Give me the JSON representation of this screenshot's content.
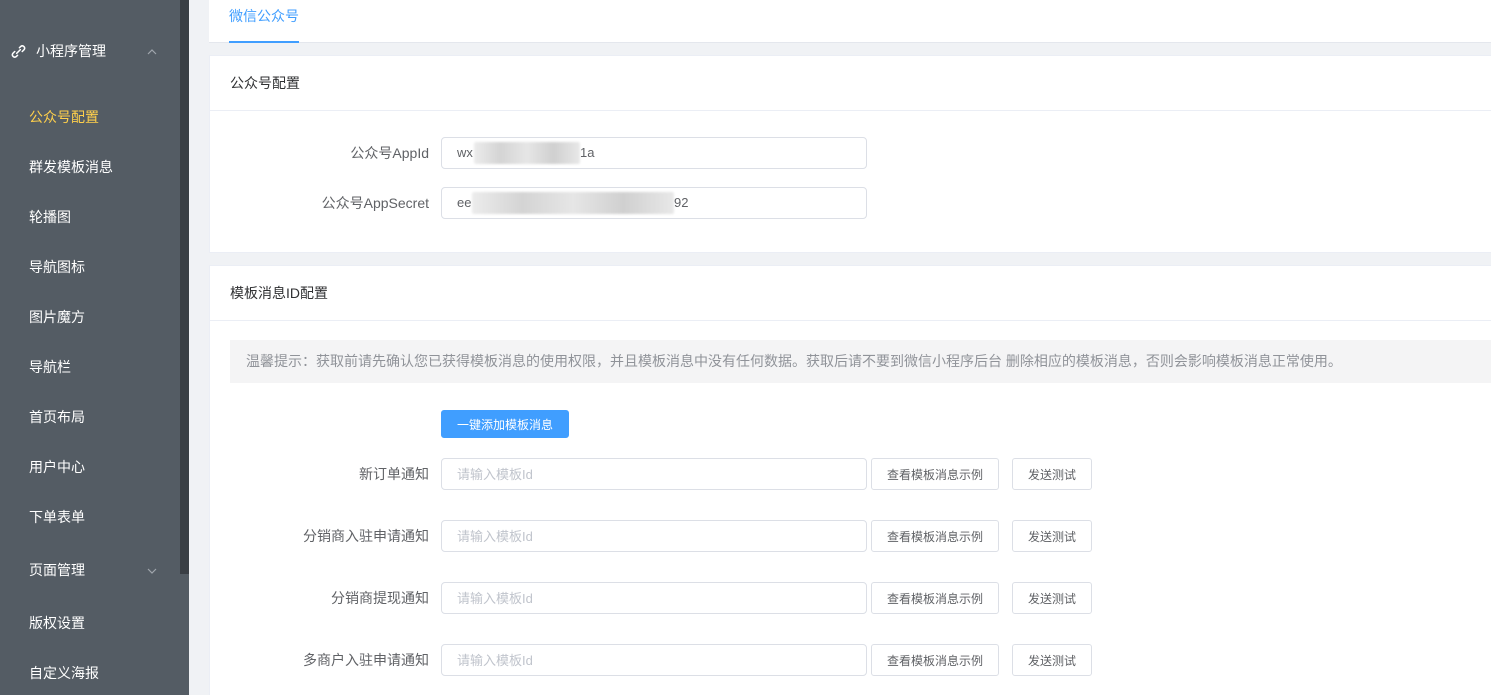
{
  "sidebar": {
    "cut_item_label": "",
    "group": {
      "label": "小程序管理",
      "icon": "link-icon",
      "expanded": true
    },
    "items": [
      {
        "label": "公众号配置",
        "active": true
      },
      {
        "label": "群发模板消息"
      },
      {
        "label": "轮播图"
      },
      {
        "label": "导航图标"
      },
      {
        "label": "图片魔方"
      },
      {
        "label": "导航栏"
      },
      {
        "label": "首页布局"
      },
      {
        "label": "用户中心"
      },
      {
        "label": "下单表单"
      },
      {
        "label": "页面管理",
        "has_submenu": true
      },
      {
        "label": "版权设置"
      },
      {
        "label": "自定义海报"
      }
    ],
    "colors": {
      "bg": "#545c64",
      "active_text": "#ffd04b",
      "text": "#ffffff"
    }
  },
  "tabs": [
    {
      "label": "微信公众号",
      "active": true
    }
  ],
  "account_card": {
    "title": "公众号配置",
    "fields": [
      {
        "label": "公众号AppId",
        "value_prefix": "wx",
        "value_suffix": "1a"
      },
      {
        "label": "公众号AppSecret",
        "value_prefix": "ee",
        "value_suffix": "92"
      }
    ]
  },
  "template_card": {
    "title": "模板消息ID配置",
    "tip": "温馨提示：获取前请先确认您已获得模板消息的使用权限，并且模板消息中没有任何数据。获取后请不要到微信小程序后台 删除相应的模板消息，否则会影响模板消息正常使用。",
    "add_button": "一键添加模板消息",
    "rows": [
      {
        "label": "新订单通知",
        "placeholder": "请输入模板Id",
        "example_button": "查看模板消息示例",
        "test_button": "发送测试"
      },
      {
        "label": "分销商入驻申请通知",
        "placeholder": "请输入模板Id",
        "example_button": "查看模板消息示例",
        "test_button": "发送测试"
      },
      {
        "label": "分销商提现通知",
        "placeholder": "请输入模板Id",
        "example_button": "查看模板消息示例",
        "test_button": "发送测试"
      },
      {
        "label": "多商户入驻申请通知",
        "placeholder": "请输入模板Id",
        "example_button": "查看模板消息示例",
        "test_button": "发送测试"
      }
    ]
  },
  "colors": {
    "primary": "#409eff",
    "page_bg": "#f0f2f5"
  }
}
